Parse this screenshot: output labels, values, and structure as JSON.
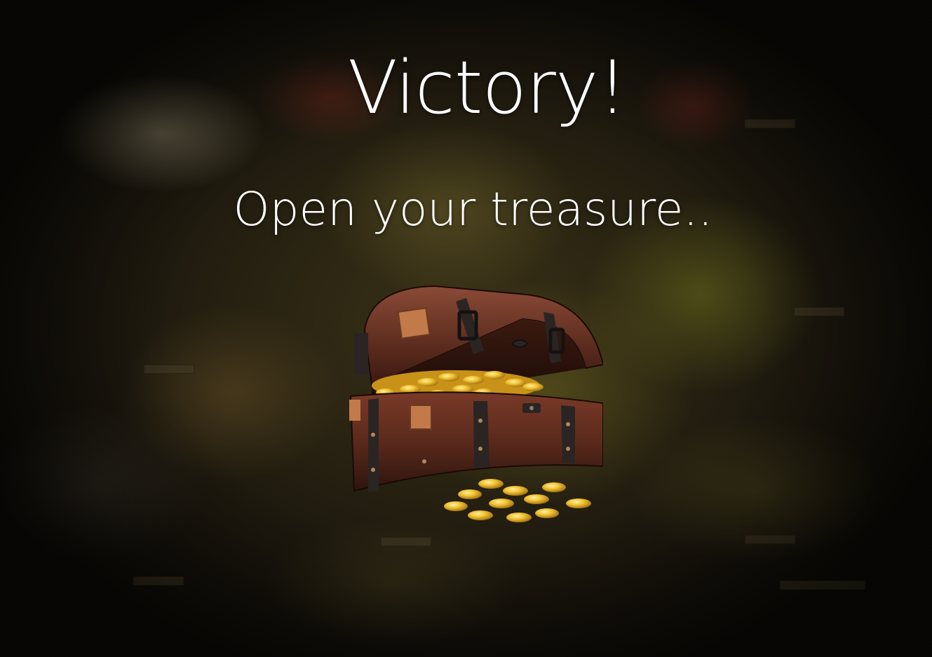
{
  "screen": {
    "title": "Victory!",
    "prompt": "Open your treasure.."
  },
  "chest": {
    "icon": "treasure-chest-icon",
    "state": "open",
    "contents": "gold-coins"
  },
  "colors": {
    "text": "#ffffff",
    "gold": "#e8b21e",
    "wood": "#5a2a1c",
    "iron": "#2a2522",
    "brass": "#c27a4a"
  }
}
